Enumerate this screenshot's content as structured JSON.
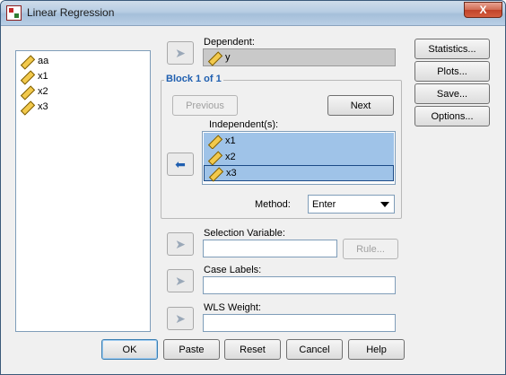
{
  "window": {
    "title": "Linear Regression",
    "close_label": "X"
  },
  "variables": [
    "aa",
    "x1",
    "x2",
    "x3"
  ],
  "dependent": {
    "label": "Dependent:",
    "value": "y"
  },
  "block": {
    "title": "Block 1 of 1",
    "previous_label": "Previous",
    "next_label": "Next",
    "independents_label": "Independent(s):",
    "independents": [
      "x1",
      "x2",
      "x3"
    ],
    "method_label": "Method:",
    "method_value": "Enter"
  },
  "selection": {
    "label": "Selection Variable:",
    "rule_label": "Rule..."
  },
  "case_labels": {
    "label": "Case Labels:"
  },
  "wls": {
    "label": "WLS Weight:"
  },
  "side_buttons": {
    "statistics": "Statistics...",
    "plots": "Plots...",
    "save": "Save...",
    "options": "Options..."
  },
  "footer_buttons": {
    "ok": "OK",
    "paste": "Paste",
    "reset": "Reset",
    "cancel": "Cancel",
    "help": "Help"
  },
  "icons": {
    "app": "spss-app-icon",
    "variable": "scale-variable-ruler-icon",
    "arrow_right": "arrow-right-icon",
    "arrow_left": "arrow-left-icon",
    "dropdown": "chevron-down-icon"
  }
}
